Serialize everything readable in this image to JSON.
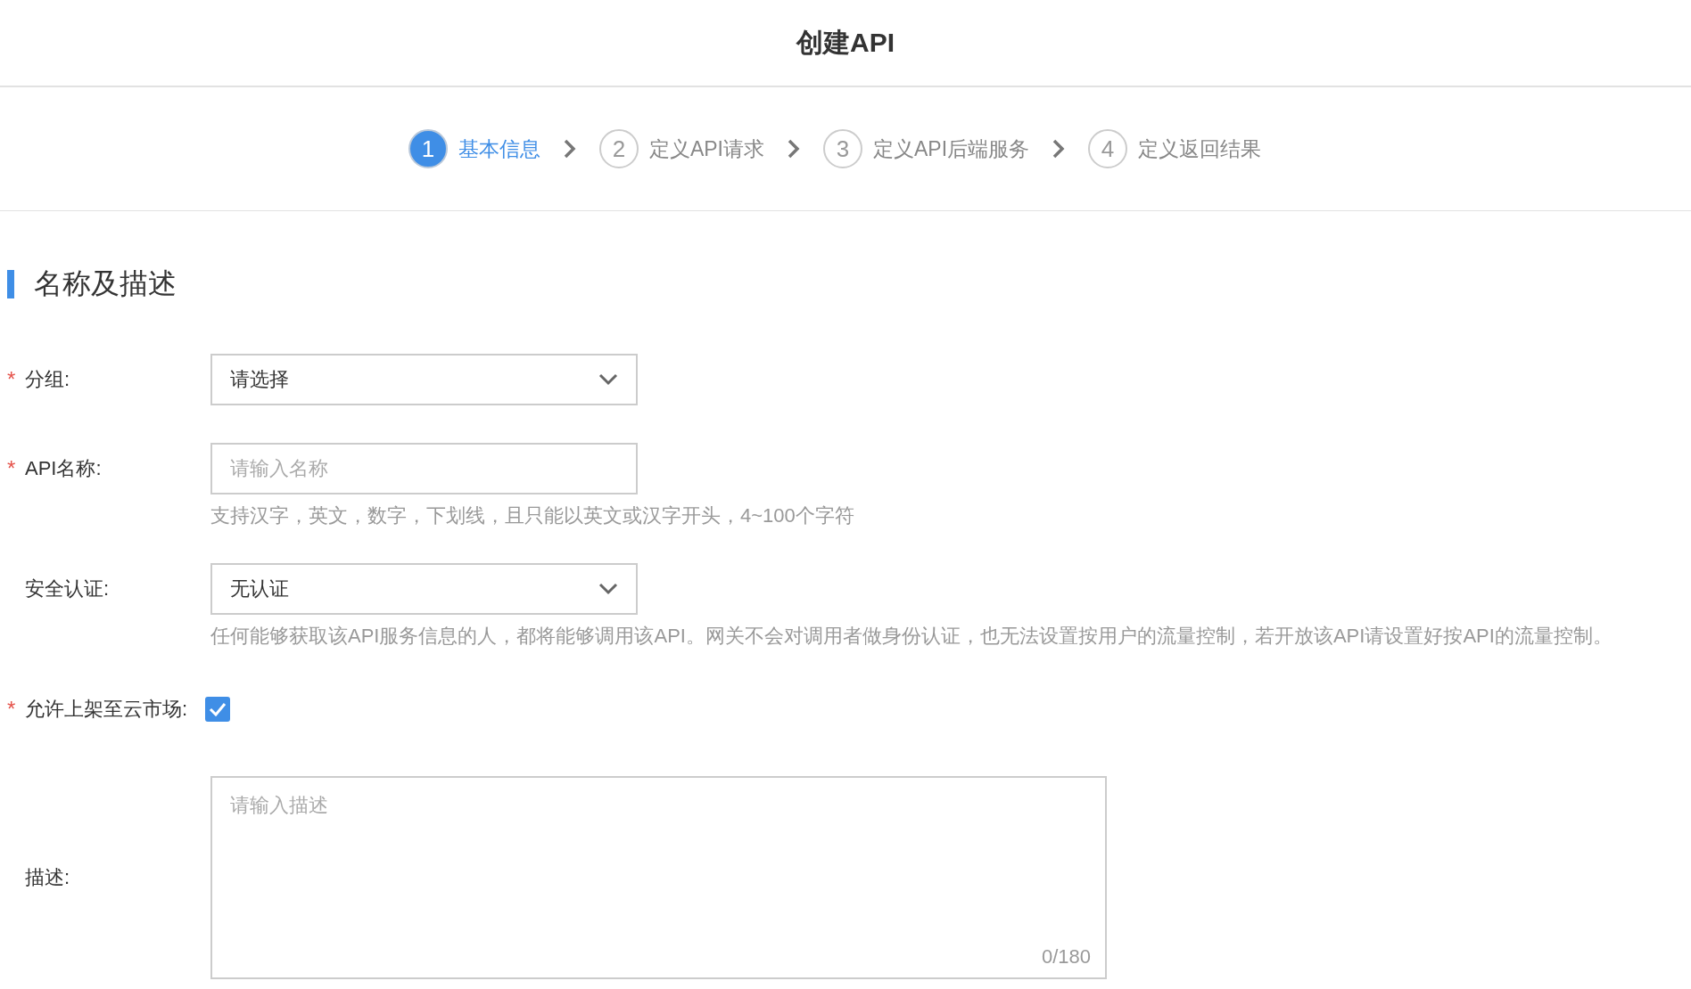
{
  "header": {
    "title": "创建API"
  },
  "steps": [
    {
      "number": "1",
      "label": "基本信息",
      "selected": true
    },
    {
      "number": "2",
      "label": "定义API请求",
      "selected": false
    },
    {
      "number": "3",
      "label": "定义API后端服务",
      "selected": false
    },
    {
      "number": "4",
      "label": "定义返回结果",
      "selected": false
    }
  ],
  "section": {
    "title": "名称及描述"
  },
  "fields": [
    {
      "kind": "select",
      "required_mark": "*",
      "label": "分组:",
      "value": "请选择"
    },
    {
      "kind": "input",
      "required_mark": "*",
      "label": "API名称:",
      "placeholder": "请输入名称",
      "hint": "支持汉字，英文，数字，下划线，且只能以英文或汉字开头，4~100个字符"
    },
    {
      "kind": "select",
      "label": "安全认证:",
      "value": "无认证",
      "hint": "任何能够获取该API服务信息的人，都将能够调用该API。网关不会对调用者做身份认证，也无法设置按用户的流量控制，若开放该API请设置好按API的流量控制。"
    },
    {
      "kind": "checkbox",
      "required_mark": "*",
      "label": "允许上架至云市场:",
      "checked": true
    },
    {
      "kind": "textarea",
      "label": "描述:",
      "placeholder": "请输入描述",
      "counter": "0/180"
    }
  ]
}
